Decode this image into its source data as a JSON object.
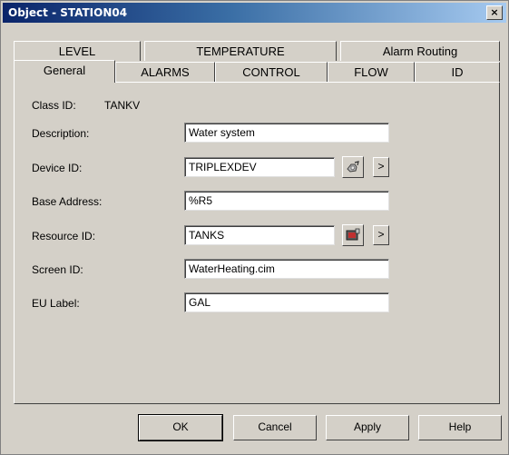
{
  "window": {
    "title": "Object - STATION04",
    "close_label": "×"
  },
  "tabs_row1": [
    {
      "label": "LEVEL"
    },
    {
      "label": "TEMPERATURE"
    },
    {
      "label": "Alarm Routing"
    }
  ],
  "tabs_row2": [
    {
      "label": "General",
      "selected": true
    },
    {
      "label": "ALARMS"
    },
    {
      "label": "CONTROL"
    },
    {
      "label": "FLOW"
    },
    {
      "label": "ID"
    }
  ],
  "general": {
    "class_id_label": "Class ID:",
    "class_id_value": "TANKV",
    "description_label": "Description:",
    "description_value": "Water system",
    "device_id_label": "Device ID:",
    "device_id_value": "TRIPLEXDEV",
    "base_address_label": "Base Address:",
    "base_address_value": "%R5",
    "resource_id_label": "Resource ID:",
    "resource_id_value": "TANKS",
    "screen_id_label": "Screen ID:",
    "screen_id_value": "WaterHeating.cim",
    "eu_label_label": "EU Label:",
    "eu_label_value": "GAL",
    "more_button_label": ">"
  },
  "buttons": {
    "ok": "OK",
    "cancel": "Cancel",
    "apply": "Apply",
    "help": "Help"
  },
  "icons": {
    "device_browse": "device-browse-icon",
    "resource_browse": "resource-browse-icon"
  }
}
